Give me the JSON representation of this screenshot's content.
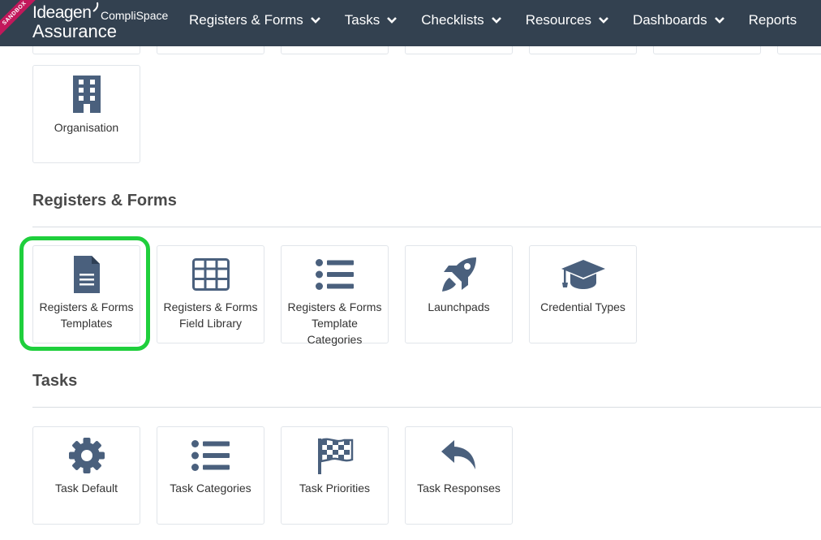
{
  "app": {
    "brand_primary": "Ideagen",
    "brand_secondary": "CompliSpace",
    "brand_product": "Assurance",
    "env_badge": "SANDBOX"
  },
  "nav": {
    "items": [
      {
        "label": "Registers & Forms",
        "has_menu": true
      },
      {
        "label": "Tasks",
        "has_menu": true
      },
      {
        "label": "Checklists",
        "has_menu": true
      },
      {
        "label": "Resources",
        "has_menu": true
      },
      {
        "label": "Dashboards",
        "has_menu": true
      },
      {
        "label": "Reports",
        "has_menu": false
      }
    ]
  },
  "top_tiles": [
    {
      "label": "Organisation",
      "icon": "building-icon"
    }
  ],
  "sections": [
    {
      "title": "Registers & Forms",
      "tiles": [
        {
          "label": "Registers & Forms Templates",
          "icon": "document-icon",
          "highlighted": true
        },
        {
          "label": "Registers & Forms Field Library",
          "icon": "table-icon"
        },
        {
          "label": "Registers & Forms Template Categories",
          "icon": "list-icon"
        },
        {
          "label": "Launchpads",
          "icon": "rocket-icon"
        },
        {
          "label": "Credential Types",
          "icon": "graduation-cap-icon"
        }
      ]
    },
    {
      "title": "Tasks",
      "tiles": [
        {
          "label": "Task Default",
          "icon": "gear-icon"
        },
        {
          "label": "Task Categories",
          "icon": "list-icon"
        },
        {
          "label": "Task Priorities",
          "icon": "checkered-flag-icon"
        },
        {
          "label": "Task Responses",
          "icon": "reply-arrow-icon"
        }
      ]
    }
  ],
  "colors": {
    "nav_bg": "#334150",
    "icon": "#4a607d",
    "highlight": "#1fcf3c",
    "badge": "#c2185b"
  }
}
